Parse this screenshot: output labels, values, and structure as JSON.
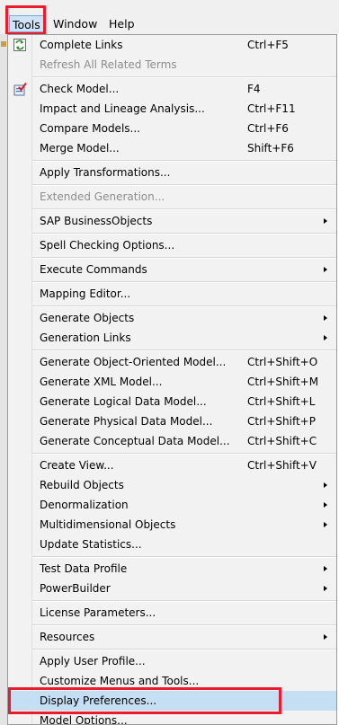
{
  "menubar": {
    "tools": "Tools",
    "window": "Window",
    "help": "Help"
  },
  "menu": {
    "complete_links": {
      "label": "Complete Links",
      "shortcut": "Ctrl+F5"
    },
    "refresh_related": {
      "label": "Refresh All Related Terms"
    },
    "check_model": {
      "label": "Check Model...",
      "shortcut": "F4"
    },
    "impact_lineage": {
      "label": "Impact and Lineage Analysis...",
      "shortcut": "Ctrl+F11"
    },
    "compare_models": {
      "label": "Compare Models...",
      "shortcut": "Ctrl+F6"
    },
    "merge_model": {
      "label": "Merge Model...",
      "shortcut": "Shift+F6"
    },
    "apply_transformations": {
      "label": "Apply Transformations..."
    },
    "extended_generation": {
      "label": "Extended Generation..."
    },
    "sap_businessobjects": {
      "label": "SAP BusinessObjects"
    },
    "spell_checking": {
      "label": "Spell Checking Options..."
    },
    "execute_commands": {
      "label": "Execute Commands"
    },
    "mapping_editor": {
      "label": "Mapping Editor..."
    },
    "generate_objects": {
      "label": "Generate Objects"
    },
    "generation_links": {
      "label": "Generation Links"
    },
    "gen_oo_model": {
      "label": "Generate Object-Oriented Model...",
      "shortcut": "Ctrl+Shift+O"
    },
    "gen_xml_model": {
      "label": "Generate XML Model...",
      "shortcut": "Ctrl+Shift+M"
    },
    "gen_logical": {
      "label": "Generate Logical Data Model...",
      "shortcut": "Ctrl+Shift+L"
    },
    "gen_physical": {
      "label": "Generate Physical Data Model...",
      "shortcut": "Ctrl+Shift+P"
    },
    "gen_conceptual": {
      "label": "Generate Conceptual Data Model...",
      "shortcut": "Ctrl+Shift+C"
    },
    "create_view": {
      "label": "Create View...",
      "shortcut": "Ctrl+Shift+V"
    },
    "rebuild_objects": {
      "label": "Rebuild Objects"
    },
    "denormalization": {
      "label": "Denormalization"
    },
    "multidimensional": {
      "label": "Multidimensional Objects"
    },
    "update_statistics": {
      "label": "Update Statistics..."
    },
    "test_data_profile": {
      "label": "Test Data Profile"
    },
    "powerbuilder": {
      "label": "PowerBuilder"
    },
    "license_parameters": {
      "label": "License Parameters..."
    },
    "resources": {
      "label": "Resources"
    },
    "apply_user_profile": {
      "label": "Apply User Profile..."
    },
    "customize_menus": {
      "label": "Customize Menus and Tools..."
    },
    "display_preferences": {
      "label": "Display Preferences..."
    },
    "model_options": {
      "label": "Model Options..."
    }
  }
}
